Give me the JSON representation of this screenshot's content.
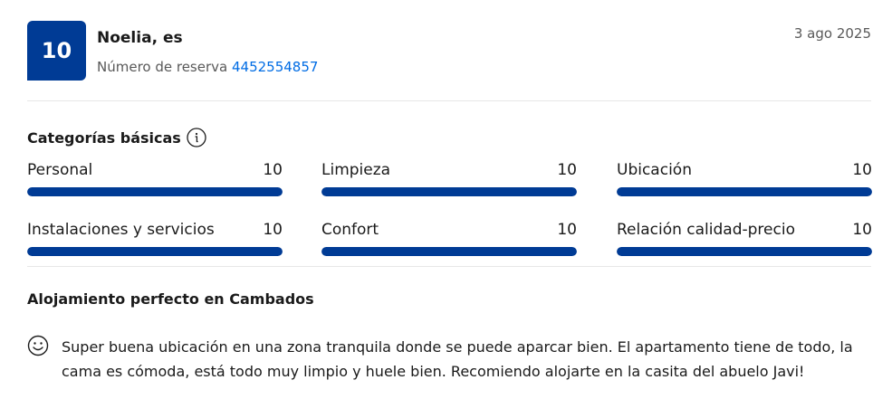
{
  "review": {
    "score": "10",
    "reviewer_name": "Noelia, es",
    "booking_label": "Número de reserva",
    "booking_number": "4452554857",
    "date": "3 ago 2025"
  },
  "categories": {
    "title": "Categorías básicas",
    "info_icon": "info-icon",
    "items": [
      {
        "label": "Personal",
        "value": "10",
        "level": 1.0
      },
      {
        "label": "Limpieza",
        "value": "10",
        "level": 1.0
      },
      {
        "label": "Ubicación",
        "value": "10",
        "level": 1.0
      },
      {
        "label": "Instalaciones y servicios",
        "value": "10",
        "level": 1.0
      },
      {
        "label": "Confort",
        "value": "10",
        "level": 1.0
      },
      {
        "label": "Relación calidad-precio",
        "value": "10",
        "level": 1.0
      }
    ]
  },
  "comment": {
    "title": "Alojamiento perfecto en Cambados",
    "icon": "smiley-icon",
    "text": "Super buena ubicación en una zona tranquila donde se puede aparcar bien. El apartamento tiene de todo, la cama es cómoda, está todo muy limpio y huele bien. Recomiendo alojarte en la casita del abuelo Javi!"
  },
  "colors": {
    "brand_blue": "#003b95",
    "link_blue": "#006ce4"
  }
}
